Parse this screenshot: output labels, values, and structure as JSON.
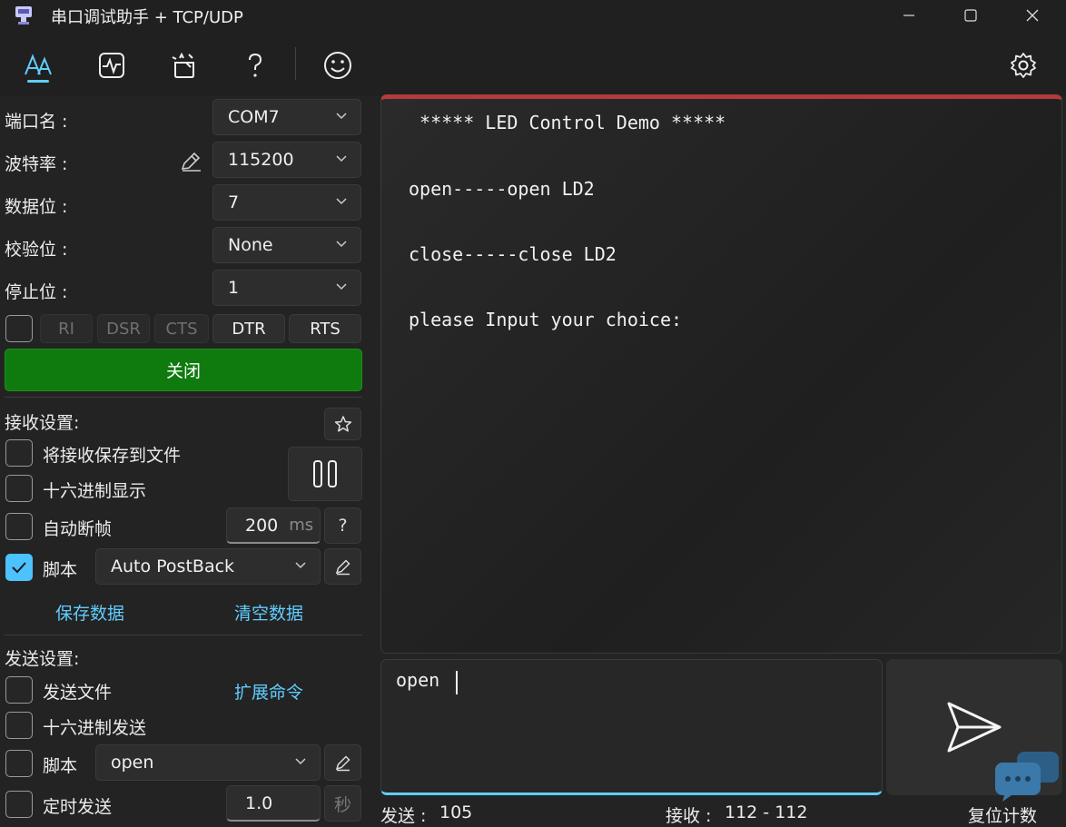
{
  "window": {
    "title": "串口调试助手 + TCP/UDP"
  },
  "toolbar": {
    "icons": [
      "text-font-icon",
      "pulse-icon",
      "magic-icon",
      "help-icon",
      "smiley-icon",
      "settings-gear-icon"
    ]
  },
  "serial": {
    "port_label": "端口名 :",
    "port_value": "COM7",
    "baud_label": "波特率 :",
    "baud_value": "115200",
    "databits_label": "数据位 :",
    "databits_value": "7",
    "parity_label": "校验位 :",
    "parity_value": "None",
    "stopbits_label": "停止位 :",
    "stopbits_value": "1",
    "signals": [
      "RI",
      "DSR",
      "CTS",
      "DTR",
      "RTS"
    ],
    "close_label": "关闭"
  },
  "receive": {
    "title": "接收设置:",
    "save_to_file": "将接收保存到文件",
    "hex_display": "十六进制显示",
    "auto_frame": "自动断帧",
    "frame_ms": "200",
    "frame_unit": "ms",
    "help": "?",
    "script_label": "脚本",
    "script_value": "Auto PostBack",
    "save_data": "保存数据",
    "clear_data": "清空数据"
  },
  "send": {
    "title": "发送设置:",
    "send_file": "发送文件",
    "ext_cmd": "扩展命令",
    "hex_send": "十六进制发送",
    "script_label": "脚本",
    "script_value": "open",
    "timed_send": "定时发送",
    "interval": "1.0",
    "interval_unit": "秒"
  },
  "terminal": {
    "lines": [
      " ***** LED Control Demo *****",
      "open-----open LD2",
      "close-----close LD2",
      "please Input your choice:"
    ]
  },
  "input": {
    "value": "open "
  },
  "status": {
    "sent_label": "发送 :",
    "sent_value": "105",
    "recv_label": "接收 :",
    "recv_value": "112 - 112",
    "reset": "复位计数"
  },
  "colors": {
    "accent": "#60cdff",
    "close_button": "#0f7b0f",
    "terminal_top": "#b33b3b"
  }
}
